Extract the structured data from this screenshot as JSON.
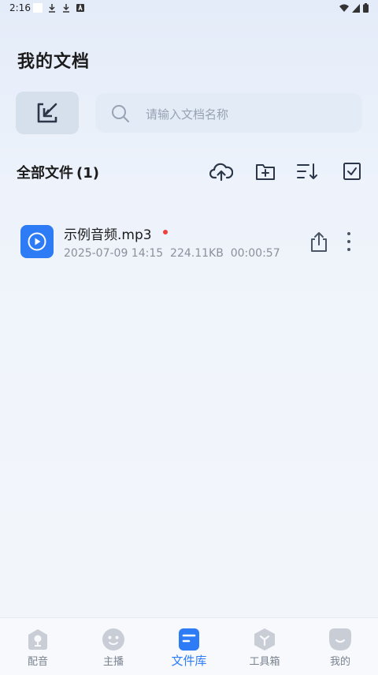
{
  "status_bar": {
    "time": "2:16"
  },
  "page": {
    "title": "我的文档"
  },
  "search": {
    "placeholder": "请输入文档名称"
  },
  "section": {
    "title": "全部文件",
    "count": "(1)"
  },
  "toolbar": {
    "icons": [
      "cloud-upload-icon",
      "new-folder-icon",
      "sort-icon",
      "select-all-icon"
    ]
  },
  "files": [
    {
      "name": "示例音频.mp3",
      "meta": "2025-07-09 14:15  224.11KB  00:00:57",
      "new_indicator_color": "#f0403c"
    }
  ],
  "bottom_nav": {
    "items": [
      {
        "label": "配音",
        "icon": "mic-icon"
      },
      {
        "label": "主播",
        "icon": "anchor-face-icon"
      },
      {
        "label": "文件库",
        "icon": "file-library-icon",
        "active": true
      },
      {
        "label": "工具箱",
        "icon": "toolbox-icon"
      },
      {
        "label": "我的",
        "icon": "profile-icon"
      }
    ]
  },
  "colors": {
    "accent": "#2d7cf6",
    "text_primary": "#1c1c1c",
    "text_secondary": "#8a919c",
    "nav_inactive": "#7a8290"
  }
}
